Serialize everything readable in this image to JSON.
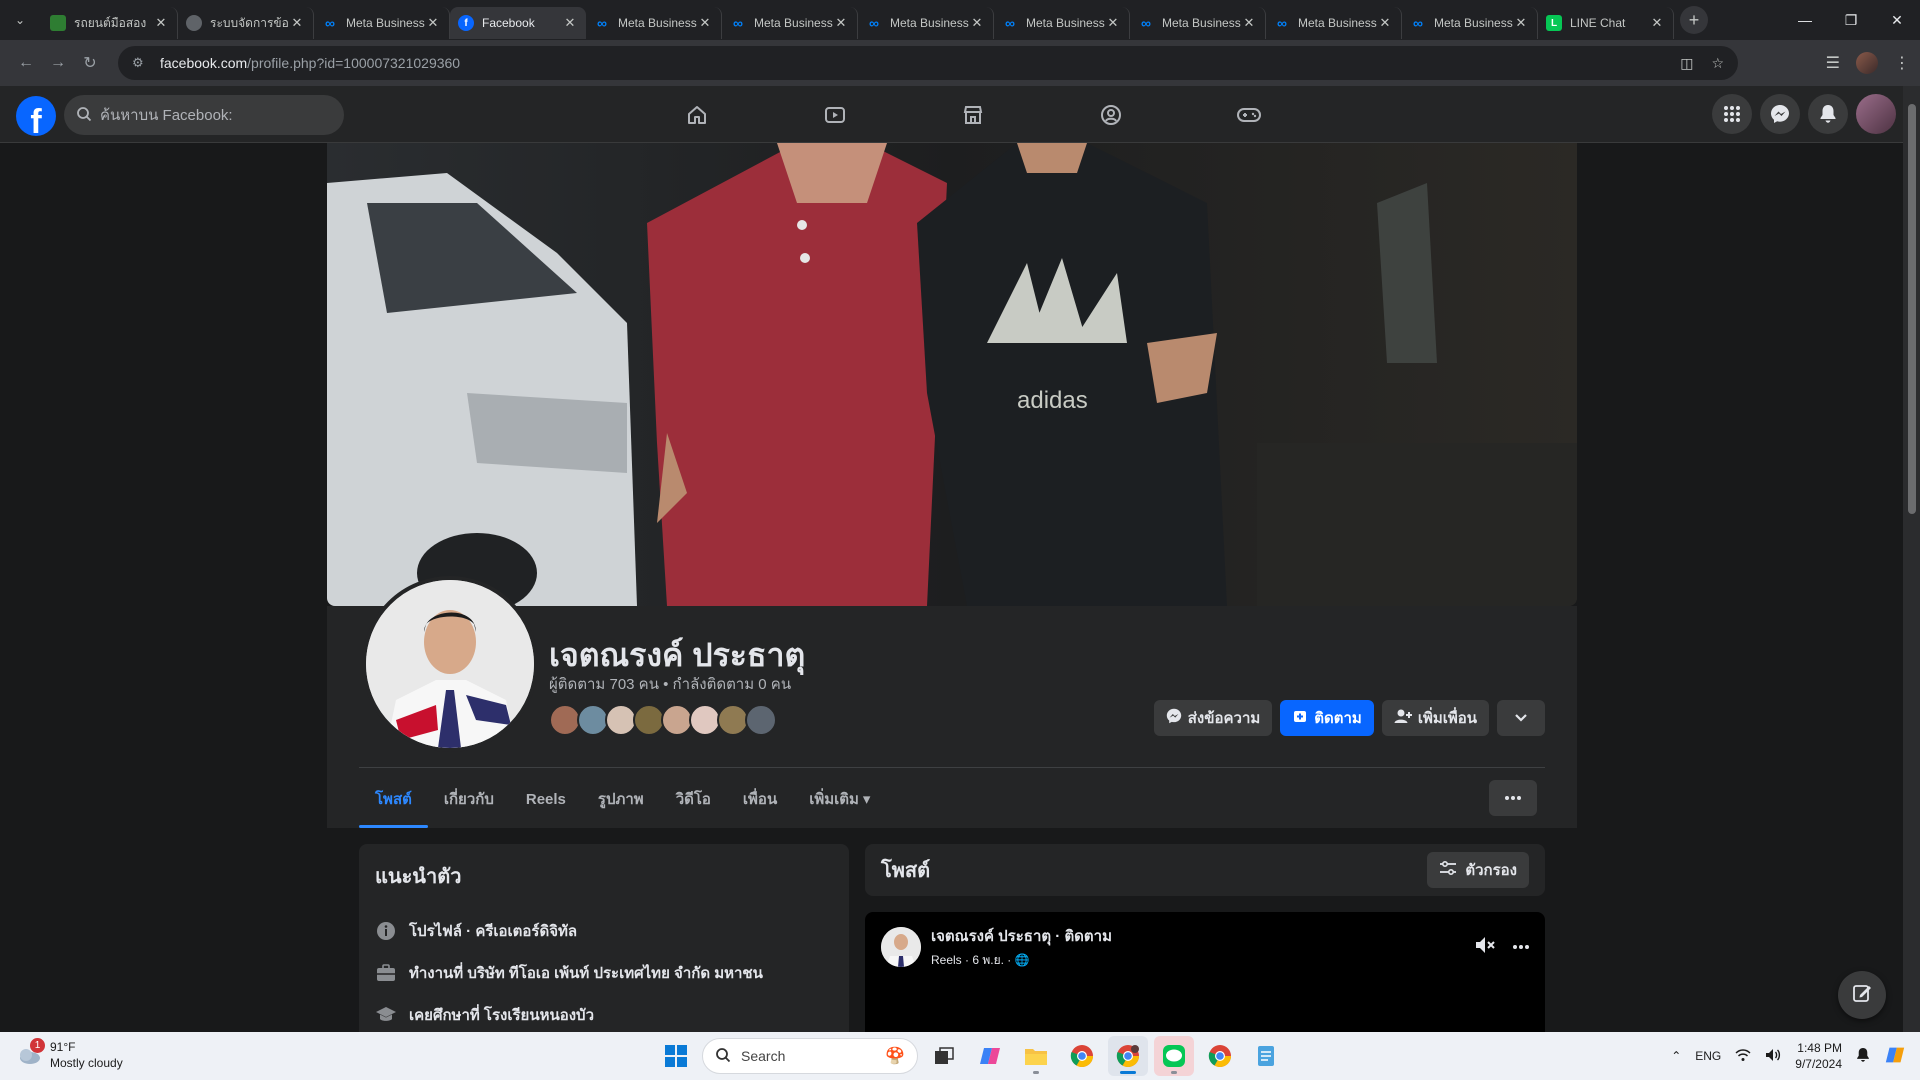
{
  "browser": {
    "tabs": [
      {
        "title": "รถยนต์มือสอง",
        "icon": "site-icon",
        "color": "#2e7d32",
        "active": false
      },
      {
        "title": "ระบบจัดการข้อ",
        "icon": "globe-icon",
        "color": "#5f6368",
        "active": false
      },
      {
        "title": "Meta Business",
        "icon": "meta-icon",
        "color": "#0081fb",
        "active": false
      },
      {
        "title": "Facebook",
        "icon": "facebook-icon",
        "color": "#0866ff",
        "active": true
      },
      {
        "title": "Meta Business",
        "icon": "meta-icon",
        "color": "#0081fb",
        "active": false
      },
      {
        "title": "Meta Business",
        "icon": "meta-icon",
        "color": "#0081fb",
        "active": false
      },
      {
        "title": "Meta Business",
        "icon": "meta-icon",
        "color": "#0081fb",
        "active": false
      },
      {
        "title": "Meta Business",
        "icon": "meta-icon",
        "color": "#0081fb",
        "active": false
      },
      {
        "title": "Meta Business",
        "icon": "meta-icon",
        "color": "#0081fb",
        "active": false
      },
      {
        "title": "Meta Business",
        "icon": "meta-icon",
        "color": "#0081fb",
        "active": false
      },
      {
        "title": "Meta Business",
        "icon": "meta-icon",
        "color": "#0081fb",
        "active": false
      },
      {
        "title": "LINE Chat",
        "icon": "line-icon",
        "color": "#06c755",
        "active": false
      }
    ],
    "url_host": "facebook.com",
    "url_path": "/profile.php?id=100007321029360"
  },
  "facebook": {
    "search_placeholder": "ค้นหาบน Facebook:",
    "brand_color": "#0866ff"
  },
  "profile": {
    "name": "เจตณรงค์ ประธาตุ",
    "stats": "ผู้ติดตาม 703 คน • กำลังติดตาม 0 คน",
    "buttons": {
      "message": "ส่งข้อความ",
      "follow": "ติดตาม",
      "add_friend": "เพิ่มเพื่อน"
    },
    "tabs": [
      "โพสต์",
      "เกี่ยวกับ",
      "Reels",
      "รูปภาพ",
      "วิดีโอ",
      "เพื่อน",
      "เพิ่มเติม"
    ]
  },
  "intro": {
    "title": "แนะนำตัว",
    "items": [
      {
        "icon": "info-icon",
        "bold": "โปรไฟล์",
        "text": " · ครีเอเตอร์ดิจิทัล"
      },
      {
        "icon": "briefcase-icon",
        "bold": "",
        "text": "ทำงานที่ บริษัท ทีโอเอ เพ้นท์ ประเทศไทย จำกัด มหาชน"
      },
      {
        "icon": "graduation-cap-icon",
        "bold": "",
        "text": "เคยศึกษาที่ โรงเรียนหนองบัว"
      }
    ]
  },
  "posts": {
    "title": "โพสต์",
    "filter_label": "ตัวกรอง",
    "first_post": {
      "author": "เจตณรงค์ ประธาตุ · ติดตาม",
      "meta": "Reels · 6 พ.ย. · "
    }
  },
  "taskbar": {
    "weather_temp": "91°F",
    "weather_desc": "Mostly cloudy",
    "weather_badge": "1",
    "search_label": "Search",
    "lang": "ENG",
    "time": "1:48 PM",
    "date": "9/7/2024"
  }
}
